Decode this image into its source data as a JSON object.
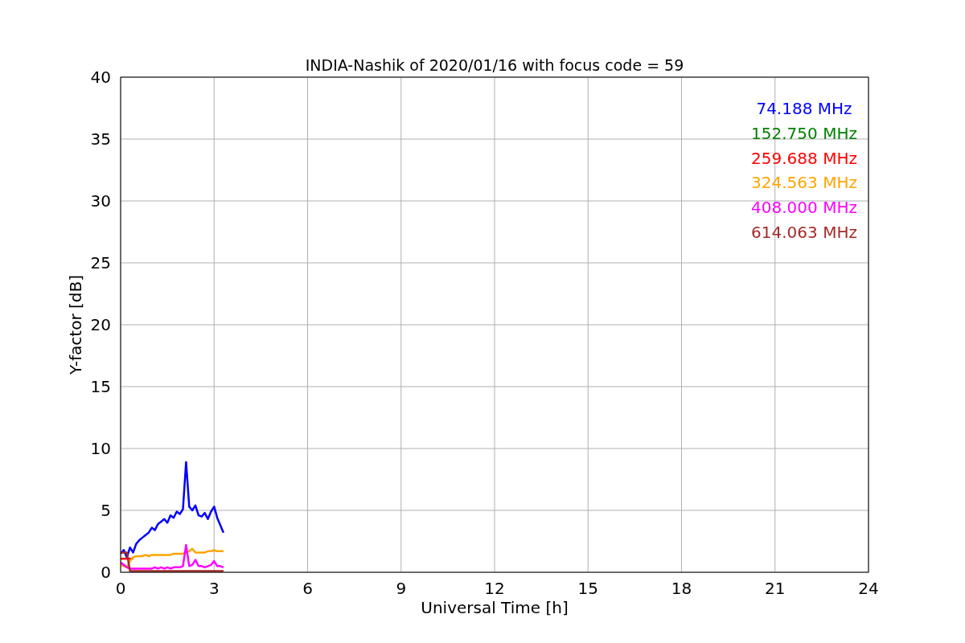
{
  "figure": {
    "chart_data": {
      "type": "line",
      "title": "INDIA-Nashik of 2020/01/16 with focus code = 59",
      "xlabel": "Universal Time [h]",
      "ylabel": "Y-factor [dB]",
      "grid": true,
      "x": [
        0,
        0.1,
        0.2,
        0.3,
        0.4,
        0.5,
        0.6,
        0.7,
        0.8,
        0.9,
        1.0,
        1.1,
        1.2,
        1.3,
        1.4,
        1.5,
        1.6,
        1.7,
        1.8,
        1.9,
        2.0,
        2.1,
        2.2,
        2.3,
        2.4,
        2.5,
        2.6,
        2.7,
        2.8,
        2.9,
        3.0,
        3.1,
        3.2,
        3.3
      ],
      "xlim": [
        0,
        24
      ],
      "ylim": [
        0,
        40
      ],
      "xticks": [
        0,
        3,
        6,
        9,
        12,
        15,
        18,
        21,
        24
      ],
      "yticks": [
        0,
        5,
        10,
        15,
        20,
        25,
        30,
        35,
        40
      ],
      "series": [
        {
          "name": "74.188 MHz",
          "color": "#0000ff",
          "values": [
            1.5,
            1.8,
            1.2,
            2.0,
            1.6,
            2.3,
            2.6,
            2.8,
            3.0,
            3.2,
            3.6,
            3.4,
            3.9,
            4.1,
            4.3,
            4.0,
            4.6,
            4.4,
            4.9,
            4.7,
            5.1,
            8.9,
            5.3,
            5.0,
            5.4,
            4.6,
            4.5,
            4.8,
            4.3,
            4.9,
            5.3,
            4.4,
            3.8,
            3.2
          ]
        },
        {
          "name": "152.750 MHz",
          "color": "#008000",
          "values": [
            null,
            null,
            null,
            null,
            null,
            null,
            null,
            null,
            null,
            null,
            null,
            null,
            null,
            null,
            null,
            null,
            null,
            null,
            null,
            null,
            null,
            null,
            null,
            null,
            null,
            null,
            null,
            null,
            null,
            null,
            null,
            null,
            null,
            null
          ]
        },
        {
          "name": "259.688 MHz",
          "color": "#ff0000",
          "values": [
            1.1,
            1.1,
            1.1,
            1.1,
            1.1,
            null,
            null,
            null,
            null,
            null,
            null,
            null,
            null,
            null,
            null,
            null,
            null,
            null,
            null,
            null,
            null,
            null,
            null,
            null,
            null,
            null,
            null,
            null,
            null,
            null,
            null,
            null,
            null,
            null
          ]
        },
        {
          "name": "324.563 MHz",
          "color": "#ffa500",
          "values": [
            0.6,
            0.5,
            0.4,
            0.9,
            1.2,
            1.3,
            1.3,
            1.3,
            1.4,
            1.3,
            1.4,
            1.4,
            1.4,
            1.4,
            1.4,
            1.4,
            1.4,
            1.5,
            1.5,
            1.5,
            1.5,
            1.6,
            1.7,
            1.9,
            1.6,
            1.6,
            1.6,
            1.6,
            1.7,
            1.7,
            1.8,
            1.7,
            1.7,
            1.7
          ]
        },
        {
          "name": "408.000 MHz",
          "color": "#ff00ff",
          "values": [
            0.8,
            0.6,
            0.4,
            0.3,
            0.3,
            0.3,
            0.3,
            0.3,
            0.3,
            0.3,
            0.3,
            0.4,
            0.3,
            0.4,
            0.3,
            0.4,
            0.3,
            0.4,
            0.4,
            0.4,
            0.5,
            2.2,
            0.5,
            0.6,
            1.0,
            0.5,
            0.5,
            0.4,
            0.5,
            0.6,
            0.9,
            0.5,
            0.5,
            0.4
          ]
        },
        {
          "name": "614.063 MHz",
          "color": "#a52a2a",
          "values": [
            1.6,
            1.6,
            1.6,
            0.1,
            0.1,
            0.1,
            0.1,
            0.1,
            0.1,
            0.1,
            0.1,
            0.1,
            0.1,
            0.1,
            0.1,
            0.1,
            0.1,
            0.1,
            0.1,
            0.1,
            0.1,
            0.1,
            0.1,
            0.1,
            0.1,
            0.1,
            0.1,
            0.1,
            0.1,
            0.1,
            0.1,
            0.1,
            0.1,
            0.1
          ]
        }
      ]
    }
  }
}
